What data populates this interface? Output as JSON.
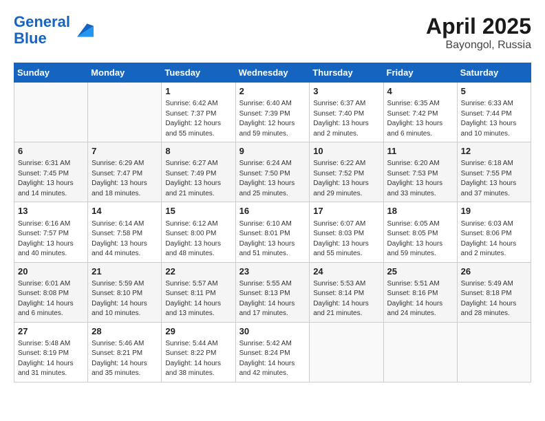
{
  "logo": {
    "line1": "General",
    "line2": "Blue"
  },
  "title": "April 2025",
  "location": "Bayongol, Russia",
  "days_of_week": [
    "Sunday",
    "Monday",
    "Tuesday",
    "Wednesday",
    "Thursday",
    "Friday",
    "Saturday"
  ],
  "weeks": [
    [
      {
        "day": "",
        "info": ""
      },
      {
        "day": "",
        "info": ""
      },
      {
        "day": "1",
        "info": "Sunrise: 6:42 AM\nSunset: 7:37 PM\nDaylight: 12 hours and 55 minutes."
      },
      {
        "day": "2",
        "info": "Sunrise: 6:40 AM\nSunset: 7:39 PM\nDaylight: 12 hours and 59 minutes."
      },
      {
        "day": "3",
        "info": "Sunrise: 6:37 AM\nSunset: 7:40 PM\nDaylight: 13 hours and 2 minutes."
      },
      {
        "day": "4",
        "info": "Sunrise: 6:35 AM\nSunset: 7:42 PM\nDaylight: 13 hours and 6 minutes."
      },
      {
        "day": "5",
        "info": "Sunrise: 6:33 AM\nSunset: 7:44 PM\nDaylight: 13 hours and 10 minutes."
      }
    ],
    [
      {
        "day": "6",
        "info": "Sunrise: 6:31 AM\nSunset: 7:45 PM\nDaylight: 13 hours and 14 minutes."
      },
      {
        "day": "7",
        "info": "Sunrise: 6:29 AM\nSunset: 7:47 PM\nDaylight: 13 hours and 18 minutes."
      },
      {
        "day": "8",
        "info": "Sunrise: 6:27 AM\nSunset: 7:49 PM\nDaylight: 13 hours and 21 minutes."
      },
      {
        "day": "9",
        "info": "Sunrise: 6:24 AM\nSunset: 7:50 PM\nDaylight: 13 hours and 25 minutes."
      },
      {
        "day": "10",
        "info": "Sunrise: 6:22 AM\nSunset: 7:52 PM\nDaylight: 13 hours and 29 minutes."
      },
      {
        "day": "11",
        "info": "Sunrise: 6:20 AM\nSunset: 7:53 PM\nDaylight: 13 hours and 33 minutes."
      },
      {
        "day": "12",
        "info": "Sunrise: 6:18 AM\nSunset: 7:55 PM\nDaylight: 13 hours and 37 minutes."
      }
    ],
    [
      {
        "day": "13",
        "info": "Sunrise: 6:16 AM\nSunset: 7:57 PM\nDaylight: 13 hours and 40 minutes."
      },
      {
        "day": "14",
        "info": "Sunrise: 6:14 AM\nSunset: 7:58 PM\nDaylight: 13 hours and 44 minutes."
      },
      {
        "day": "15",
        "info": "Sunrise: 6:12 AM\nSunset: 8:00 PM\nDaylight: 13 hours and 48 minutes."
      },
      {
        "day": "16",
        "info": "Sunrise: 6:10 AM\nSunset: 8:01 PM\nDaylight: 13 hours and 51 minutes."
      },
      {
        "day": "17",
        "info": "Sunrise: 6:07 AM\nSunset: 8:03 PM\nDaylight: 13 hours and 55 minutes."
      },
      {
        "day": "18",
        "info": "Sunrise: 6:05 AM\nSunset: 8:05 PM\nDaylight: 13 hours and 59 minutes."
      },
      {
        "day": "19",
        "info": "Sunrise: 6:03 AM\nSunset: 8:06 PM\nDaylight: 14 hours and 2 minutes."
      }
    ],
    [
      {
        "day": "20",
        "info": "Sunrise: 6:01 AM\nSunset: 8:08 PM\nDaylight: 14 hours and 6 minutes."
      },
      {
        "day": "21",
        "info": "Sunrise: 5:59 AM\nSunset: 8:10 PM\nDaylight: 14 hours and 10 minutes."
      },
      {
        "day": "22",
        "info": "Sunrise: 5:57 AM\nSunset: 8:11 PM\nDaylight: 14 hours and 13 minutes."
      },
      {
        "day": "23",
        "info": "Sunrise: 5:55 AM\nSunset: 8:13 PM\nDaylight: 14 hours and 17 minutes."
      },
      {
        "day": "24",
        "info": "Sunrise: 5:53 AM\nSunset: 8:14 PM\nDaylight: 14 hours and 21 minutes."
      },
      {
        "day": "25",
        "info": "Sunrise: 5:51 AM\nSunset: 8:16 PM\nDaylight: 14 hours and 24 minutes."
      },
      {
        "day": "26",
        "info": "Sunrise: 5:49 AM\nSunset: 8:18 PM\nDaylight: 14 hours and 28 minutes."
      }
    ],
    [
      {
        "day": "27",
        "info": "Sunrise: 5:48 AM\nSunset: 8:19 PM\nDaylight: 14 hours and 31 minutes."
      },
      {
        "day": "28",
        "info": "Sunrise: 5:46 AM\nSunset: 8:21 PM\nDaylight: 14 hours and 35 minutes."
      },
      {
        "day": "29",
        "info": "Sunrise: 5:44 AM\nSunset: 8:22 PM\nDaylight: 14 hours and 38 minutes."
      },
      {
        "day": "30",
        "info": "Sunrise: 5:42 AM\nSunset: 8:24 PM\nDaylight: 14 hours and 42 minutes."
      },
      {
        "day": "",
        "info": ""
      },
      {
        "day": "",
        "info": ""
      },
      {
        "day": "",
        "info": ""
      }
    ]
  ]
}
